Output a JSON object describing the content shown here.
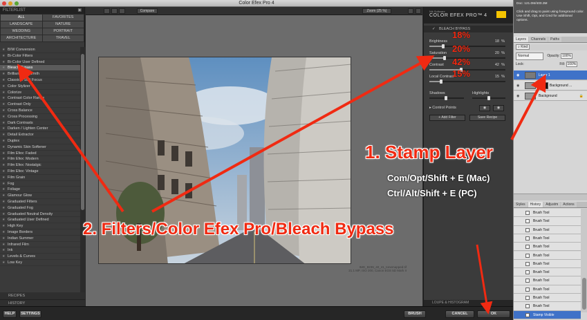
{
  "window": {
    "title": "Color Efex Pro 4"
  },
  "left_panel": {
    "header": "FILTERLIST",
    "categories": [
      "ALL",
      "FAVORITES",
      "LANDSCAPE",
      "NATURE",
      "WEDDING",
      "PORTRAIT",
      "ARCHITECTURE",
      "TRAVEL"
    ],
    "filters": [
      "B/W Conversion",
      "Bi-Color Filters",
      "Bi-Color User Defined",
      "Bleach Bypass",
      "Brilliance / Warmth",
      "Classical Soft Focus",
      "Color Stylizer",
      "Colorize",
      "Contrast Color Range",
      "Contrast Only",
      "Cross Balance",
      "Cross Processing",
      "Dark Contrasts",
      "Darken / Lighten Center",
      "Detail Extractor",
      "Duplex",
      "Dynamic Skin Softener",
      "Film Efex: Faded",
      "Film Efex: Modern",
      "Film Efex: Nostalgic",
      "Film Efex: Vintage",
      "Film Grain",
      "Fog",
      "Foliage",
      "Glamour Glow",
      "Graduated Filters",
      "Graduated Fog",
      "Graduated Neutral Density",
      "Graduated User Defined",
      "High Key",
      "Image Borders",
      "Indian Summer",
      "Infrared Film",
      "Ink",
      "Levels & Curves",
      "Low Key"
    ],
    "selected_filter": "Bleach Bypass",
    "recipes_label": "RECIPES",
    "history_label": "HISTORY",
    "help_label": "HELP",
    "settings_label": "SETTINGS"
  },
  "toolbar": {
    "compare_label": "Compare",
    "zoom_label": "Zoom (25 %)"
  },
  "image": {
    "caption_line1": "IMG_8239_40_41_tonemapped.tif",
    "caption_line2": "21.1 MP, ISO 200, Canon EOS 5D Mark II"
  },
  "right_panel": {
    "brand_small": "Nik Software",
    "brand_name": "COLOR EFEX PRO™ 4",
    "filter_header": "BLEACH BYPASS",
    "sliders": [
      {
        "label": "Brightness",
        "value": "18",
        "unit": "%",
        "fraction": 0.18
      },
      {
        "label": "Saturation",
        "value": "20",
        "unit": "%",
        "fraction": 0.2
      },
      {
        "label": "Contrast",
        "value": "42",
        "unit": "%",
        "fraction": 0.42
      },
      {
        "label": "Local Contrast",
        "value": "15",
        "unit": "%",
        "fraction": 0.15
      }
    ],
    "shadows_label": "Shadows",
    "highlights_label": "Highlights",
    "control_points_label": "Control Points",
    "add_filter_label": "+ Add Filter",
    "save_recipe_label": "Save Recipe",
    "loupe_label": "LOUPE & HISTOGRAM",
    "brush_label": "BRUSH",
    "cancel_label": "CANCEL",
    "ok_label": "OK"
  },
  "overlays": {
    "brightness_pct": "18%",
    "saturation_pct": "20%",
    "contrast_pct": "42%",
    "local_contrast_pct": "15%",
    "step1": "1. Stamp Layer",
    "mac_shortcut": "Com/Opt/Shift + E (Mac)",
    "pc_shortcut": "Ctrl/Alt/Shift + E (PC)",
    "step2": "2. Filters/Color Efex Pro/Bleach Bypass"
  },
  "photoshop": {
    "doc_info": "Doc: 121.0M/400.3M",
    "hint": "Click and drag to paint using foreground color. Use Shift, Opt, and Cmd for additional options.",
    "layer_tabs": [
      "Layers",
      "Channels",
      "Paths"
    ],
    "kind_label": "Kind",
    "blend_mode": "Normal",
    "opacity_label": "Opacity:",
    "opacity_value": "100%",
    "lock_label": "Lock:",
    "fill_label": "Fill:",
    "fill_value": "100%",
    "layers": [
      "Layer 1",
      "Background ...",
      "Background"
    ],
    "history_tabs": [
      "Styles",
      "History",
      "Adjustm",
      "Actions"
    ],
    "history_items": [
      "Brush Tool",
      "Brush Tool",
      "Brush Tool",
      "Brush Tool",
      "Brush Tool",
      "Brush Tool",
      "Brush Tool",
      "Brush Tool",
      "Brush Tool",
      "Brush Tool",
      "Brush Tool",
      "Brush Tool",
      "Stamp Visible"
    ]
  }
}
